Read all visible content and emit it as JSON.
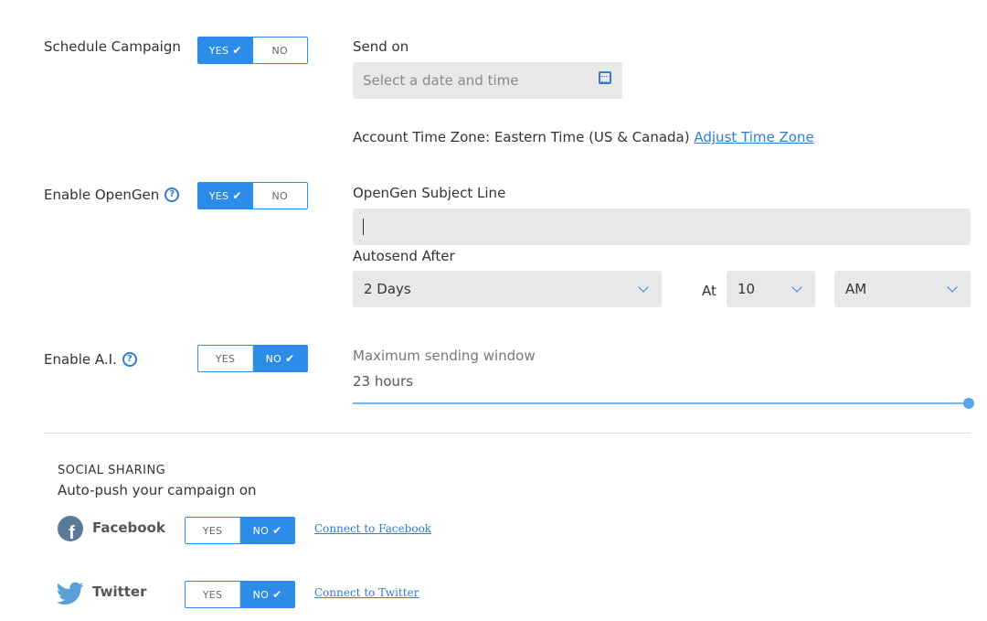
{
  "schedule": {
    "label": "Schedule Campaign",
    "toggle": {
      "yes": "YES",
      "no": "NO",
      "selected": "yes"
    },
    "send_on_label": "Send on",
    "date_placeholder": "Select a date and time",
    "timezone_text": "Account Time Zone: Eastern Time (US & Canada)",
    "timezone_link": "Adjust Time Zone"
  },
  "opengen": {
    "label": "Enable OpenGen",
    "toggle": {
      "yes": "YES",
      "no": "NO",
      "selected": "yes"
    },
    "subject_label": "OpenGen Subject Line",
    "subject_value": "",
    "autosend_label": "Autosend After",
    "autosend_value": "2 Days",
    "at_label": "At",
    "hour_value": "10",
    "ampm_value": "AM"
  },
  "ai": {
    "label": "Enable A.I.",
    "toggle": {
      "yes": "YES",
      "no": "NO",
      "selected": "no"
    },
    "window_label": "Maximum sending window",
    "window_value": "23 hours",
    "slider_fraction": 1.0
  },
  "social": {
    "title": "SOCIAL SHARING",
    "subtitle": "Auto-push your campaign on",
    "facebook": {
      "label": "Facebook",
      "toggle": {
        "yes": "YES",
        "no": "NO",
        "selected": "no"
      },
      "link": "Connect to Facebook"
    },
    "twitter": {
      "label": "Twitter",
      "toggle": {
        "yes": "YES",
        "no": "NO",
        "selected": "no"
      },
      "link": "Connect to Twitter"
    }
  },
  "colors": {
    "accent": "#2d8ce8",
    "link": "#2d7dd2",
    "field_bg": "#e8e8e8"
  }
}
